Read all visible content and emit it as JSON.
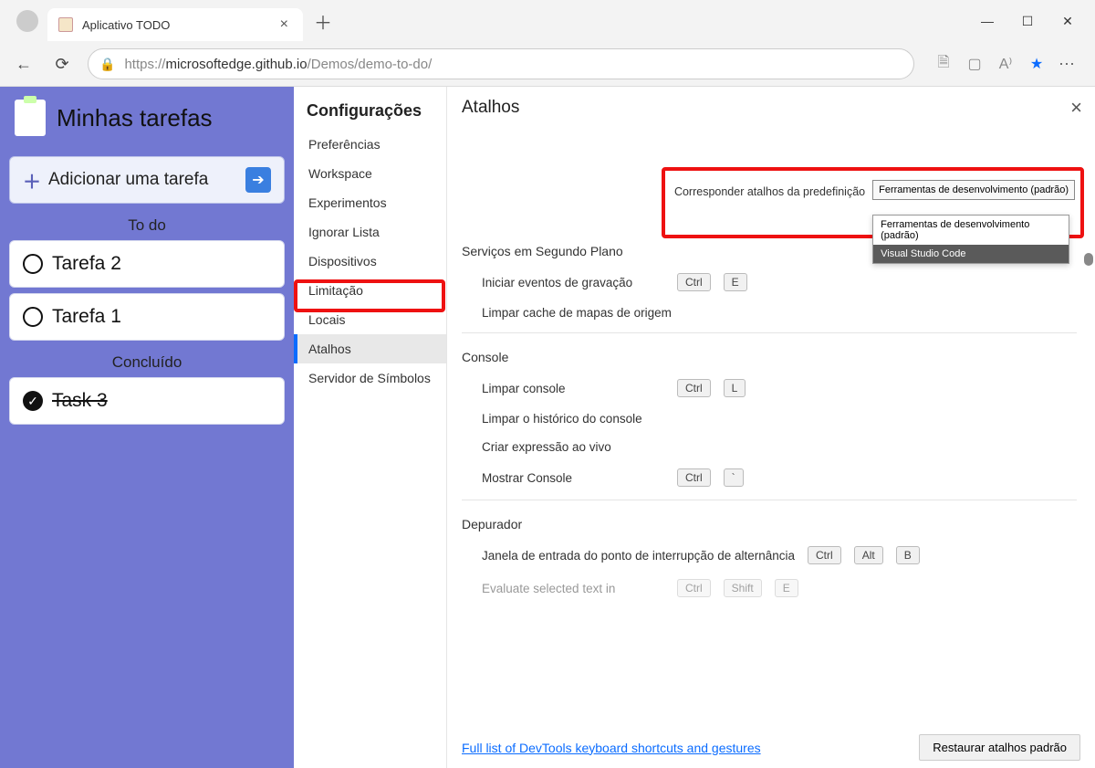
{
  "browser": {
    "tab_title": "Aplicativo TODO",
    "url_prefix": "https://",
    "url_host": "microsoftedge.github.io",
    "url_path": "/Demos/demo-to-do/"
  },
  "todo": {
    "title": "Minhas tarefas",
    "add_label": "Adicionar uma tarefa",
    "todo_header": "To do",
    "done_header": "Concluído",
    "tasks_open": [
      "Tarefa 2",
      "Tarefa 1"
    ],
    "tasks_done": [
      "Task 3"
    ]
  },
  "settings": {
    "title": "Configurações",
    "nav": [
      "Preferências",
      "Workspace",
      "Experimentos",
      "Ignorar Lista",
      "Dispositivos",
      "Limitação",
      "Locais",
      "Atalhos",
      "Servidor de Símbolos"
    ],
    "active_index": 7
  },
  "shortcuts": {
    "panel_title": "Atalhos",
    "preset_label": "Corresponder atalhos da predefinição",
    "preset_selected": "Ferramentas de desenvolvimento (padrão)",
    "preset_options": [
      "Ferramentas de desenvolvimento (padrão)",
      "Visual Studio Code"
    ],
    "sections": {
      "bg": {
        "title": "Serviços em Segundo Plano",
        "rows": [
          {
            "label": "Iniciar eventos de gravação",
            "keys": [
              "Ctrl",
              "E"
            ]
          },
          {
            "label": "Limpar cache de mapas de origem",
            "keys": []
          }
        ]
      },
      "console": {
        "title": "Console",
        "rows": [
          {
            "label": "Limpar console",
            "keys": [
              "Ctrl",
              "L"
            ]
          },
          {
            "label": "Limpar o histórico do console",
            "keys": []
          },
          {
            "label": "Criar expressão ao vivo",
            "keys": []
          },
          {
            "label": "Mostrar Console",
            "keys": [
              "Ctrl",
              "`"
            ]
          }
        ]
      },
      "debugger": {
        "title": "Depurador",
        "rows": [
          {
            "label": "Janela de entrada do ponto de interrupção de alternância",
            "keys": [
              "Ctrl",
              "Alt",
              "B"
            ]
          },
          {
            "label": "Evaluate selected text in",
            "keys": [
              "Ctrl",
              "Shift",
              "E"
            ]
          }
        ]
      }
    },
    "footer_link": "Full list of DevTools keyboard shortcuts and gestures",
    "restore_label": "Restaurar atalhos padrão"
  }
}
